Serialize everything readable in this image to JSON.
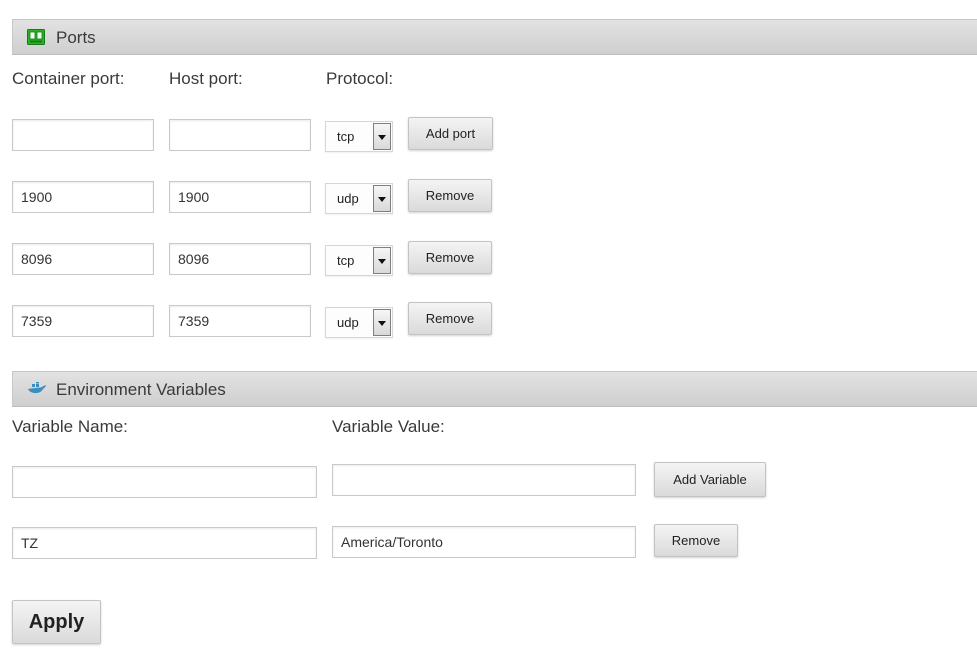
{
  "ports": {
    "title": "Ports",
    "icon": "network-port-icon",
    "labels": {
      "container": "Container port:",
      "host": "Host port:",
      "protocol": "Protocol:"
    },
    "new_row": {
      "container_value": "",
      "host_value": "",
      "protocol": "tcp",
      "button": "Add port"
    },
    "rows": [
      {
        "container": "1900",
        "host": "1900",
        "protocol": "udp",
        "button": "Remove"
      },
      {
        "container": "8096",
        "host": "8096",
        "protocol": "tcp",
        "button": "Remove"
      },
      {
        "container": "7359",
        "host": "7359",
        "protocol": "udp",
        "button": "Remove"
      }
    ]
  },
  "env": {
    "title": "Environment Variables",
    "icon": "docker-whale-icon",
    "labels": {
      "name": "Variable Name:",
      "value": "Variable Value:"
    },
    "new_row": {
      "name_value": "",
      "value_value": "",
      "button": "Add Variable"
    },
    "rows": [
      {
        "name": "TZ",
        "value": "America/Toronto",
        "button": "Remove"
      }
    ]
  },
  "apply_label": "Apply",
  "colors": {
    "port_icon": "#27a327",
    "whale_icon": "#3d8dbd"
  }
}
